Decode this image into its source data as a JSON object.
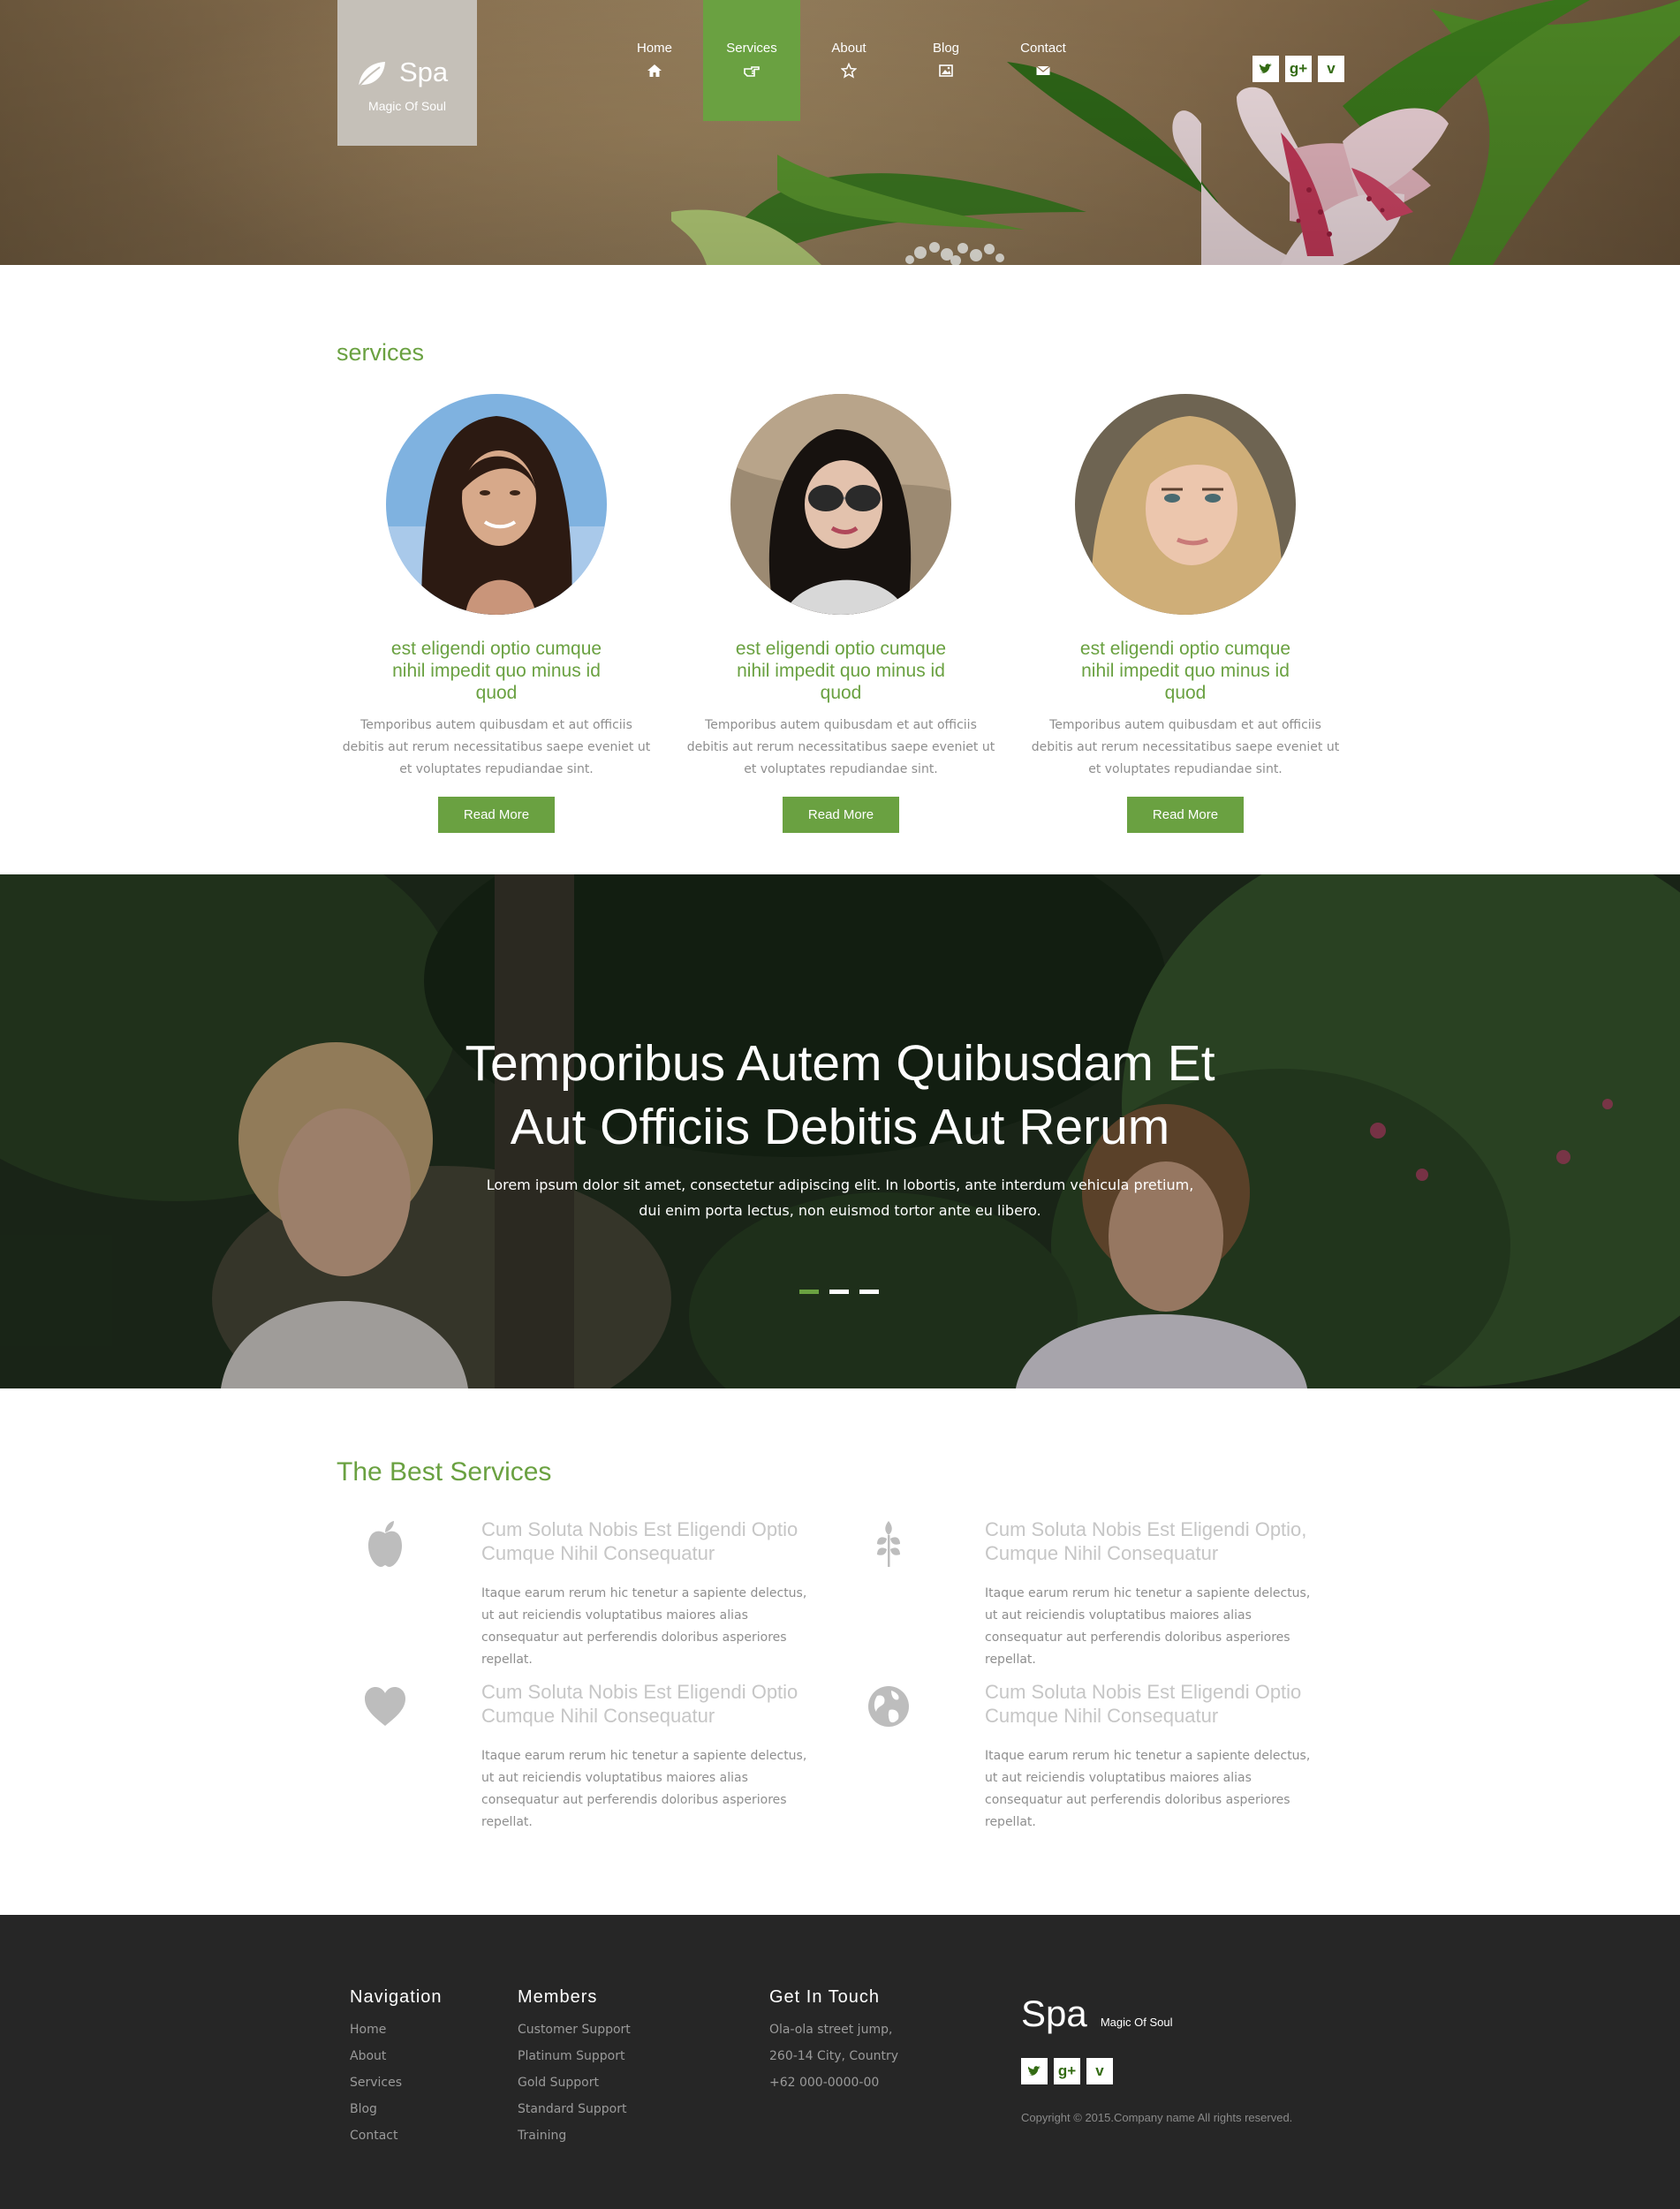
{
  "brand": {
    "title": "Spa",
    "subtitle": "Magic Of Soul"
  },
  "nav": {
    "items": [
      {
        "label": "Home",
        "icon": "home-icon"
      },
      {
        "label": "Services",
        "icon": "hand-pointer-icon",
        "active": true
      },
      {
        "label": "About",
        "icon": "star-icon"
      },
      {
        "label": "Blog",
        "icon": "image-icon"
      },
      {
        "label": "Contact",
        "icon": "envelope-icon"
      }
    ]
  },
  "social": [
    {
      "name": "twitter",
      "glyph": "❧"
    },
    {
      "name": "google-plus",
      "glyph": "g+"
    },
    {
      "name": "vimeo",
      "glyph": "v"
    }
  ],
  "services": {
    "title": "services",
    "cards": [
      {
        "heading": "est eligendi optio cumque nihil impedit quo minus id quod",
        "text": "Temporibus autem quibusdam et aut officiis debitis aut rerum necessitatibus saepe eveniet ut et voluptates repudiandae sint.",
        "button": "Read More"
      },
      {
        "heading": "est eligendi optio cumque nihil impedit quo minus id quod",
        "text": "Temporibus autem quibusdam et aut officiis debitis aut rerum necessitatibus saepe eveniet ut et voluptates repudiandae sint.",
        "button": "Read More"
      },
      {
        "heading": "est eligendi optio cumque nihil impedit quo minus id quod",
        "text": "Temporibus autem quibusdam et aut officiis debitis aut rerum necessitatibus saepe eveniet ut et voluptates repudiandae sint.",
        "button": "Read More"
      }
    ]
  },
  "banner": {
    "heading_line1": "Temporibus Autem Quibusdam Et",
    "heading_line2": "Aut Officiis Debitis Aut Rerum",
    "text_line1": "Lorem ipsum dolor sit amet, consectetur adipiscing elit. In lobortis, ante interdum vehicula pretium,",
    "text_line2": "dui enim porta lectus, non euismod tortor ante eu libero.",
    "slides": 3,
    "active_slide": 1
  },
  "best": {
    "title": "The Best Services",
    "features": [
      {
        "icon": "apple-icon",
        "heading": "Cum Soluta Nobis Est Eligendi Optio Cumque Nihil Consequatur",
        "text": "Itaque earum rerum hic tenetur a sapiente delectus, ut aut reiciendis voluptatibus maiores alias consequatur aut perferendis doloribus asperiores repellat."
      },
      {
        "icon": "wheat-icon",
        "heading": "Cum Soluta Nobis Est Eligendi Optio, Cumque Nihil Consequatur",
        "text": "Itaque earum rerum hic tenetur a sapiente delectus, ut aut reiciendis voluptatibus maiores alias consequatur aut perferendis doloribus asperiores repellat."
      },
      {
        "icon": "heart-icon",
        "heading": "Cum Soluta Nobis Est Eligendi Optio Cumque Nihil Consequatur",
        "text": "Itaque earum rerum hic tenetur a sapiente delectus, ut aut reiciendis voluptatibus maiores alias consequatur aut perferendis doloribus asperiores repellat."
      },
      {
        "icon": "globe-icon",
        "heading": "Cum Soluta Nobis Est Eligendi Optio Cumque Nihil Consequatur",
        "text": "Itaque earum rerum hic tenetur a sapiente delectus, ut aut reiciendis voluptatibus maiores alias consequatur aut perferendis doloribus asperiores repellat."
      }
    ]
  },
  "footer": {
    "navigation": {
      "heading": "Navigation",
      "links": [
        "Home",
        "About",
        "Services",
        "Blog",
        "Contact"
      ]
    },
    "members": {
      "heading": "Members",
      "links": [
        "Customer Support",
        "Platinum Support",
        "Gold Support",
        "Standard Support",
        "Training"
      ]
    },
    "contact": {
      "heading": "Get In Touch",
      "lines": [
        "Ola-ola street jump,",
        "260-14 City, Country",
        "+62 000-0000-00"
      ]
    },
    "brand_title": "Spa",
    "brand_subtitle": "Magic Of Soul",
    "copyright": "Copyright © 2015.Company name All rights reserved."
  },
  "colors": {
    "accent": "#6aa141",
    "footer_bg": "#262626",
    "logo_box": "#c5c0b8"
  }
}
